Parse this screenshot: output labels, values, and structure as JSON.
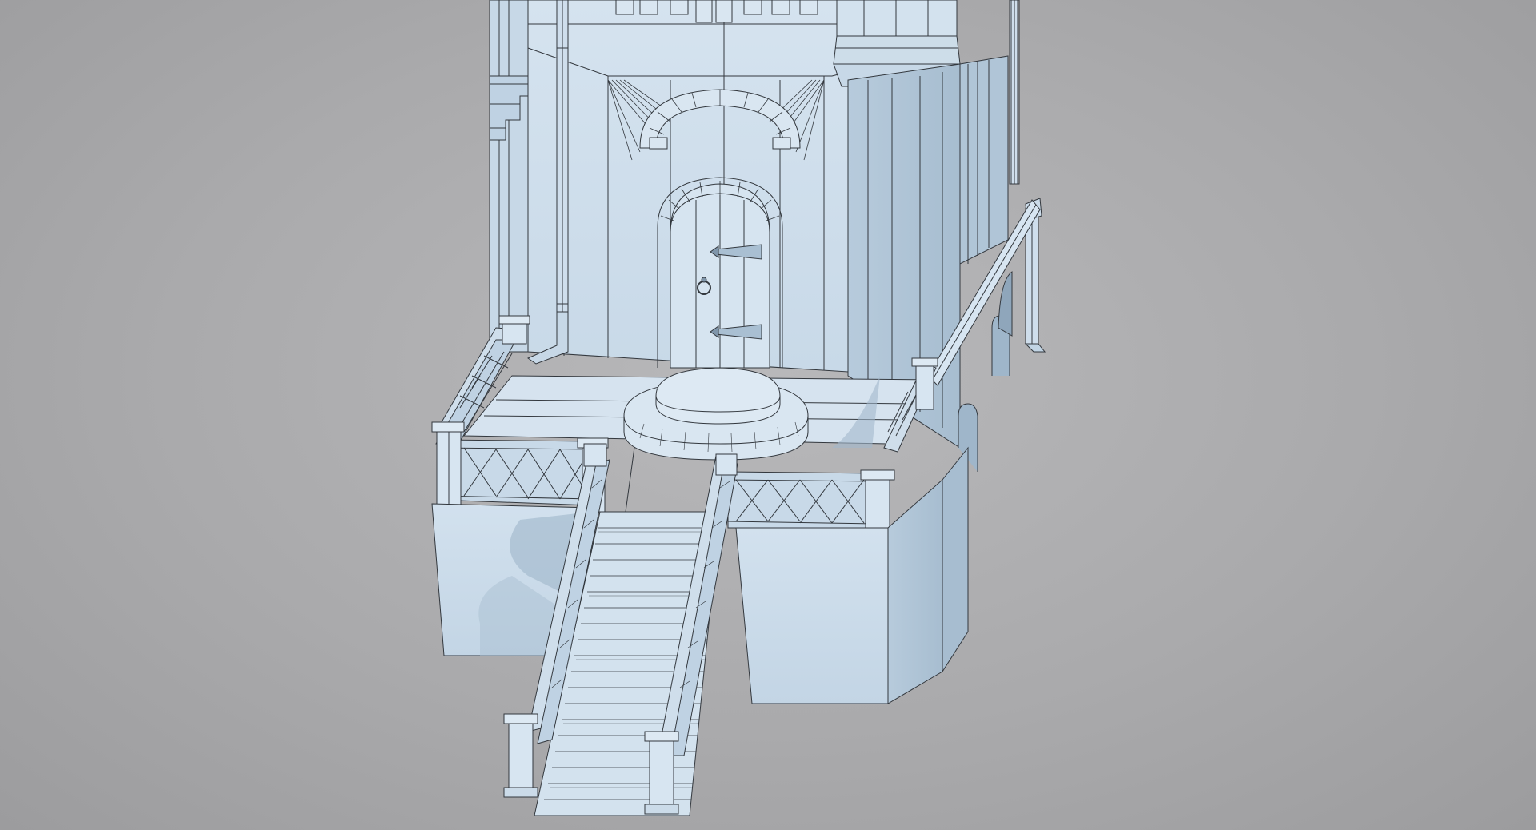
{
  "scene": {
    "subject": "wireframe-3d-model",
    "colors": {
      "background": "#aaaaac",
      "surface_light": "#dbe8f3",
      "surface_mid": "#c9dbea",
      "surface_dark": "#a9bfd2",
      "shadow": "#8fa6bb",
      "wire": "#33383e"
    }
  }
}
